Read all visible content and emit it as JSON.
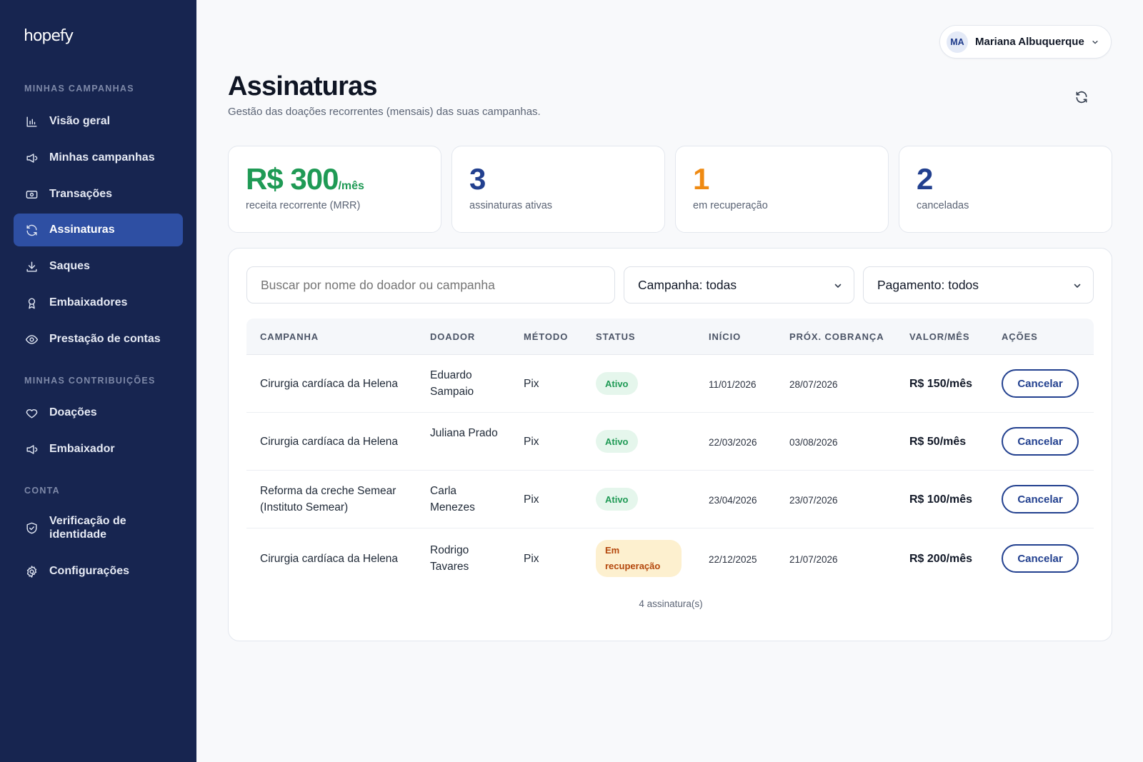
{
  "app": {
    "logo": "hopefy"
  },
  "sidebar": {
    "sections": [
      {
        "label": "MINHAS CAMPANHAS"
      },
      {
        "label": "MINHAS CONTRIBUIÇÕES"
      },
      {
        "label": "CONTA"
      }
    ],
    "items": [
      {
        "label": "Visão geral",
        "icon": "bar-chart-icon"
      },
      {
        "label": "Minhas campanhas",
        "icon": "megaphone-icon"
      },
      {
        "label": "Transações",
        "icon": "banknote-icon"
      },
      {
        "label": "Assinaturas",
        "icon": "refresh-icon",
        "active": true
      },
      {
        "label": "Saques",
        "icon": "download-icon"
      },
      {
        "label": "Embaixadores",
        "icon": "award-icon"
      },
      {
        "label": "Prestação de contas",
        "icon": "eye-icon"
      },
      {
        "label": "Doações",
        "icon": "heart-icon"
      },
      {
        "label": "Embaixador",
        "icon": "megaphone-icon"
      },
      {
        "label": "Verificação de identidade",
        "icon": "shield-check-icon"
      },
      {
        "label": "Configurações",
        "icon": "gear-icon"
      }
    ]
  },
  "user": {
    "initials": "MA",
    "name": "Mariana Albuquerque"
  },
  "header": {
    "title": "Assinaturas",
    "subtitle": "Gestão das doações recorrentes (mensais) das suas campanhas."
  },
  "stats": [
    {
      "value": "R$ 300",
      "unit": "/mês",
      "label": "receita recorrente (MRR)",
      "color": "#1f9a55"
    },
    {
      "value": "3",
      "label": "assinaturas ativas",
      "color": "#22408f"
    },
    {
      "value": "1",
      "label": "em recuperação",
      "color": "#ef8a12"
    },
    {
      "value": "2",
      "label": "canceladas",
      "color": "#22408f"
    }
  ],
  "filters": {
    "search_placeholder": "Buscar por nome do doador ou campanha",
    "campaign": "Campanha: todas",
    "payment": "Pagamento: todos"
  },
  "table": {
    "headers": [
      "CAMPANHA",
      "DOADOR",
      "MÉTODO",
      "STATUS",
      "INÍCIO",
      "PRÓX. COBRANÇA",
      "VALOR/MÊS",
      "AÇÕES"
    ],
    "rows": [
      {
        "campanha": "Cirurgia cardíaca da Helena",
        "doador": "Eduardo Sampaio",
        "metodo": "Pix",
        "status": "Ativo",
        "inicio": "11/01/2026",
        "proxima": "28/07/2026",
        "valor": "R$ 150/mês",
        "acao": "Cancelar"
      },
      {
        "campanha": "Cirurgia cardíaca da Helena",
        "doador": "Juliana Prado",
        "metodo": "Pix",
        "status": "Ativo",
        "inicio": "22/03/2026",
        "proxima": "03/08/2026",
        "valor": "R$ 50/mês",
        "acao": "Cancelar"
      },
      {
        "campanha": "Reforma da creche Semear (Instituto Semear)",
        "doador": "Carla Menezes",
        "metodo": "Pix",
        "status": "Ativo",
        "inicio": "23/04/2026",
        "proxima": "23/07/2026",
        "valor": "R$ 100/mês",
        "acao": "Cancelar"
      },
      {
        "campanha": "Cirurgia cardíaca da Helena",
        "doador": "Rodrigo Tavares",
        "metodo": "Pix",
        "status": "Em recuperação",
        "inicio": "22/12/2025",
        "proxima": "21/07/2026",
        "valor": "R$ 200/mês",
        "acao": "Cancelar"
      }
    ],
    "count": "4 assinatura(s)"
  }
}
